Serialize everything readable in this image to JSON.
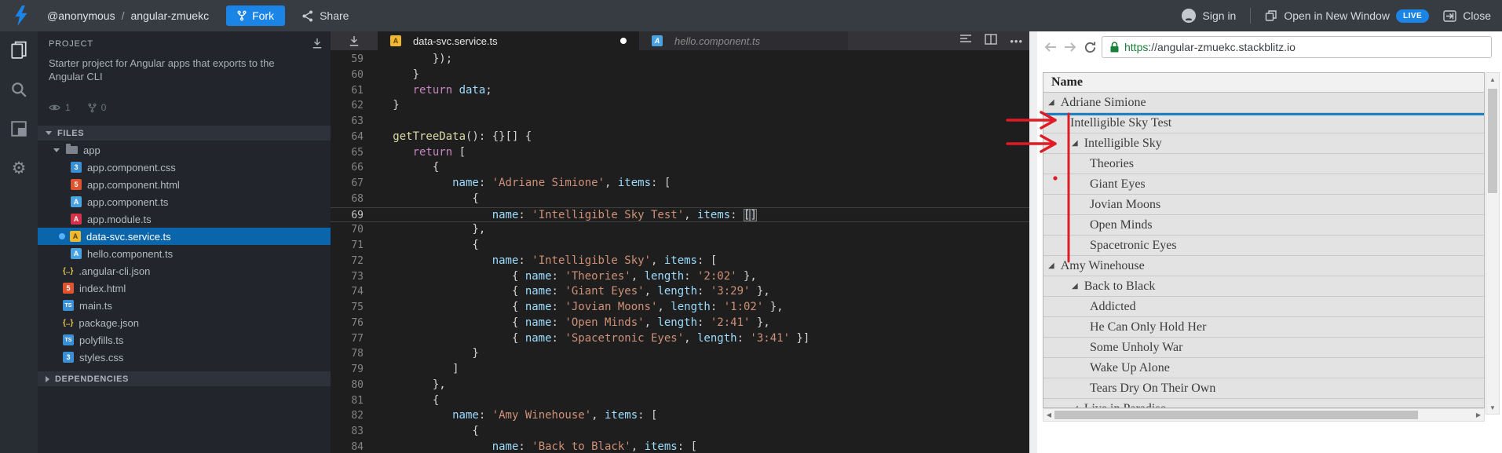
{
  "colors": {
    "accent_blue": "#1b84e7",
    "file_selection_blue": "#0a65ab",
    "preview_selection_blue": "#1b7fc4",
    "annotation_red": "#e01b24",
    "url_secure_green": "#188038"
  },
  "header": {
    "user": "@anonymous",
    "separator": "/",
    "project": "angular-zmuekc",
    "fork_label": "Fork",
    "share_label": "Share",
    "sign_in_label": "Sign in",
    "open_in_new_window_label": "Open in New Window",
    "live_badge": "LIVE",
    "close_label": "Close"
  },
  "sidebar": {
    "project_label": "PROJECT",
    "description": "Starter project for Angular apps that exports to the Angular CLI",
    "views_count": "1",
    "forks_count": "0",
    "files_label": "FILES",
    "dependencies_label": "DEPENDENCIES",
    "files": [
      {
        "label": "app",
        "icon": "folder",
        "depth": 0,
        "expandable": true
      },
      {
        "label": "app.component.css",
        "icon": "css",
        "depth": 1
      },
      {
        "label": "app.component.html",
        "icon": "html",
        "depth": 1
      },
      {
        "label": "app.component.ts",
        "icon": "angular-blue",
        "depth": 1
      },
      {
        "label": "app.module.ts",
        "icon": "angular-red",
        "depth": 1
      },
      {
        "label": "data-svc.service.ts",
        "icon": "angular-yellow",
        "depth": 1,
        "selected": true,
        "modified": true
      },
      {
        "label": "hello.component.ts",
        "icon": "angular-blue",
        "depth": 1
      },
      {
        "label": ".angular-cli.json",
        "icon": "json",
        "depth": 0
      },
      {
        "label": "index.html",
        "icon": "html",
        "depth": 0
      },
      {
        "label": "main.ts",
        "icon": "ts",
        "depth": 0
      },
      {
        "label": "package.json",
        "icon": "json",
        "depth": 0
      },
      {
        "label": "polyfills.ts",
        "icon": "ts",
        "depth": 0
      },
      {
        "label": "styles.css",
        "icon": "css",
        "depth": 0
      }
    ]
  },
  "editor": {
    "tabs": [
      {
        "label": "data-svc.service.ts",
        "icon": "angular-yellow",
        "active": true,
        "modified": true
      },
      {
        "label": "hello.component.ts",
        "icon": "angular-blue",
        "active": false,
        "modified": false
      }
    ],
    "code_lines": [
      {
        "n": "59",
        "ind": 3,
        "t": [
          [
            "p",
            "});"
          ]
        ]
      },
      {
        "n": "60",
        "ind": 2,
        "t": [
          [
            "p",
            "}"
          ]
        ]
      },
      {
        "n": "61",
        "ind": 2,
        "t": [
          [
            "k",
            "return"
          ],
          [
            "p",
            " "
          ],
          [
            "v",
            "data"
          ],
          [
            "p",
            ";"
          ]
        ]
      },
      {
        "n": "62",
        "ind": 1,
        "t": [
          [
            "p",
            "}"
          ]
        ]
      },
      {
        "n": "63",
        "ind": 0,
        "t": []
      },
      {
        "n": "64",
        "ind": 1,
        "t": [
          [
            "f",
            "getTreeData"
          ],
          [
            "p",
            "(): {}[] {"
          ]
        ]
      },
      {
        "n": "65",
        "ind": 2,
        "t": [
          [
            "k",
            "return"
          ],
          [
            "p",
            " ["
          ]
        ]
      },
      {
        "n": "66",
        "ind": 3,
        "t": [
          [
            "p",
            "{"
          ]
        ]
      },
      {
        "n": "67",
        "ind": 4,
        "t": [
          [
            "v",
            "name"
          ],
          [
            "p",
            ": "
          ],
          [
            "s",
            "'Adriane Simione'"
          ],
          [
            "p",
            ", "
          ],
          [
            "v",
            "items"
          ],
          [
            "p",
            ": ["
          ]
        ]
      },
      {
        "n": "68",
        "ind": 5,
        "t": [
          [
            "p",
            "{"
          ]
        ]
      },
      {
        "n": "69",
        "ind": 6,
        "cur": true,
        "t": [
          [
            "v",
            "name"
          ],
          [
            "p",
            ": "
          ],
          [
            "s",
            "'Intelligible Sky Test'"
          ],
          [
            "p",
            ", "
          ],
          [
            "v",
            "items"
          ],
          [
            "p",
            ": "
          ],
          [
            "bm",
            "["
          ],
          [
            "bm",
            "]"
          ]
        ]
      },
      {
        "n": "70",
        "ind": 5,
        "t": [
          [
            "p",
            "},"
          ]
        ]
      },
      {
        "n": "71",
        "ind": 5,
        "t": [
          [
            "p",
            "{"
          ]
        ]
      },
      {
        "n": "72",
        "ind": 6,
        "t": [
          [
            "v",
            "name"
          ],
          [
            "p",
            ": "
          ],
          [
            "s",
            "'Intelligible Sky'"
          ],
          [
            "p",
            ", "
          ],
          [
            "v",
            "items"
          ],
          [
            "p",
            ": ["
          ]
        ]
      },
      {
        "n": "73",
        "ind": 7,
        "t": [
          [
            "p",
            "{ "
          ],
          [
            "v",
            "name"
          ],
          [
            "p",
            ": "
          ],
          [
            "s",
            "'Theories'"
          ],
          [
            "p",
            ", "
          ],
          [
            "v",
            "length"
          ],
          [
            "p",
            ": "
          ],
          [
            "s",
            "'2:02'"
          ],
          [
            "p",
            " },"
          ]
        ]
      },
      {
        "n": "74",
        "ind": 7,
        "t": [
          [
            "p",
            "{ "
          ],
          [
            "v",
            "name"
          ],
          [
            "p",
            ": "
          ],
          [
            "s",
            "'Giant Eyes'"
          ],
          [
            "p",
            ", "
          ],
          [
            "v",
            "length"
          ],
          [
            "p",
            ": "
          ],
          [
            "s",
            "'3:29'"
          ],
          [
            "p",
            " },"
          ]
        ]
      },
      {
        "n": "75",
        "ind": 7,
        "t": [
          [
            "p",
            "{ "
          ],
          [
            "v",
            "name"
          ],
          [
            "p",
            ": "
          ],
          [
            "s",
            "'Jovian Moons'"
          ],
          [
            "p",
            ", "
          ],
          [
            "v",
            "length"
          ],
          [
            "p",
            ": "
          ],
          [
            "s",
            "'1:02'"
          ],
          [
            "p",
            " },"
          ]
        ]
      },
      {
        "n": "76",
        "ind": 7,
        "t": [
          [
            "p",
            "{ "
          ],
          [
            "v",
            "name"
          ],
          [
            "p",
            ": "
          ],
          [
            "s",
            "'Open Minds'"
          ],
          [
            "p",
            ", "
          ],
          [
            "v",
            "length"
          ],
          [
            "p",
            ": "
          ],
          [
            "s",
            "'2:41'"
          ],
          [
            "p",
            " },"
          ]
        ]
      },
      {
        "n": "77",
        "ind": 7,
        "t": [
          [
            "p",
            "{ "
          ],
          [
            "v",
            "name"
          ],
          [
            "p",
            ": "
          ],
          [
            "s",
            "'Spacetronic Eyes'"
          ],
          [
            "p",
            ", "
          ],
          [
            "v",
            "length"
          ],
          [
            "p",
            ": "
          ],
          [
            "s",
            "'3:41'"
          ],
          [
            "p",
            " }]"
          ]
        ]
      },
      {
        "n": "78",
        "ind": 5,
        "t": [
          [
            "p",
            "}"
          ]
        ]
      },
      {
        "n": "79",
        "ind": 4,
        "t": [
          [
            "p",
            "]"
          ]
        ]
      },
      {
        "n": "80",
        "ind": 3,
        "t": [
          [
            "p",
            "},"
          ]
        ]
      },
      {
        "n": "81",
        "ind": 3,
        "t": [
          [
            "p",
            "{"
          ]
        ]
      },
      {
        "n": "82",
        "ind": 4,
        "t": [
          [
            "v",
            "name"
          ],
          [
            "p",
            ": "
          ],
          [
            "s",
            "'Amy Winehouse'"
          ],
          [
            "p",
            ", "
          ],
          [
            "v",
            "items"
          ],
          [
            "p",
            ": ["
          ]
        ]
      },
      {
        "n": "83",
        "ind": 5,
        "t": [
          [
            "p",
            "{"
          ]
        ]
      },
      {
        "n": "84",
        "ind": 6,
        "t": [
          [
            "v",
            "name"
          ],
          [
            "p",
            ": "
          ],
          [
            "s",
            "'Back to Black'"
          ],
          [
            "p",
            ", "
          ],
          [
            "v",
            "items"
          ],
          [
            "p",
            ": ["
          ]
        ]
      }
    ]
  },
  "preview": {
    "url_scheme": "https",
    "url_rest": "://angular-zmuekc.stackblitz.io",
    "tree": {
      "header": "Name",
      "rows": [
        {
          "label": "Adriane Simione",
          "depth": 0,
          "expandable": true
        },
        {
          "label": "Intelligible Sky Test",
          "depth": 1,
          "selected": true
        },
        {
          "label": "Intelligible Sky",
          "depth": 1,
          "expandable": true
        },
        {
          "label": "Theories",
          "depth": 2
        },
        {
          "label": "Giant Eyes",
          "depth": 2
        },
        {
          "label": "Jovian Moons",
          "depth": 2
        },
        {
          "label": "Open Minds",
          "depth": 2
        },
        {
          "label": "Spacetronic Eyes",
          "depth": 2
        },
        {
          "label": "Amy Winehouse",
          "depth": 0,
          "expandable": true
        },
        {
          "label": "Back to Black",
          "depth": 1,
          "expandable": true
        },
        {
          "label": "Addicted",
          "depth": 2
        },
        {
          "label": "He Can Only Hold Her",
          "depth": 2
        },
        {
          "label": "Some Unholy War",
          "depth": 2
        },
        {
          "label": "Wake Up Alone",
          "depth": 2
        },
        {
          "label": "Tears Dry On Their Own",
          "depth": 2
        },
        {
          "label": "Live in Paradiso",
          "depth": 1,
          "expandable": true
        }
      ]
    }
  }
}
